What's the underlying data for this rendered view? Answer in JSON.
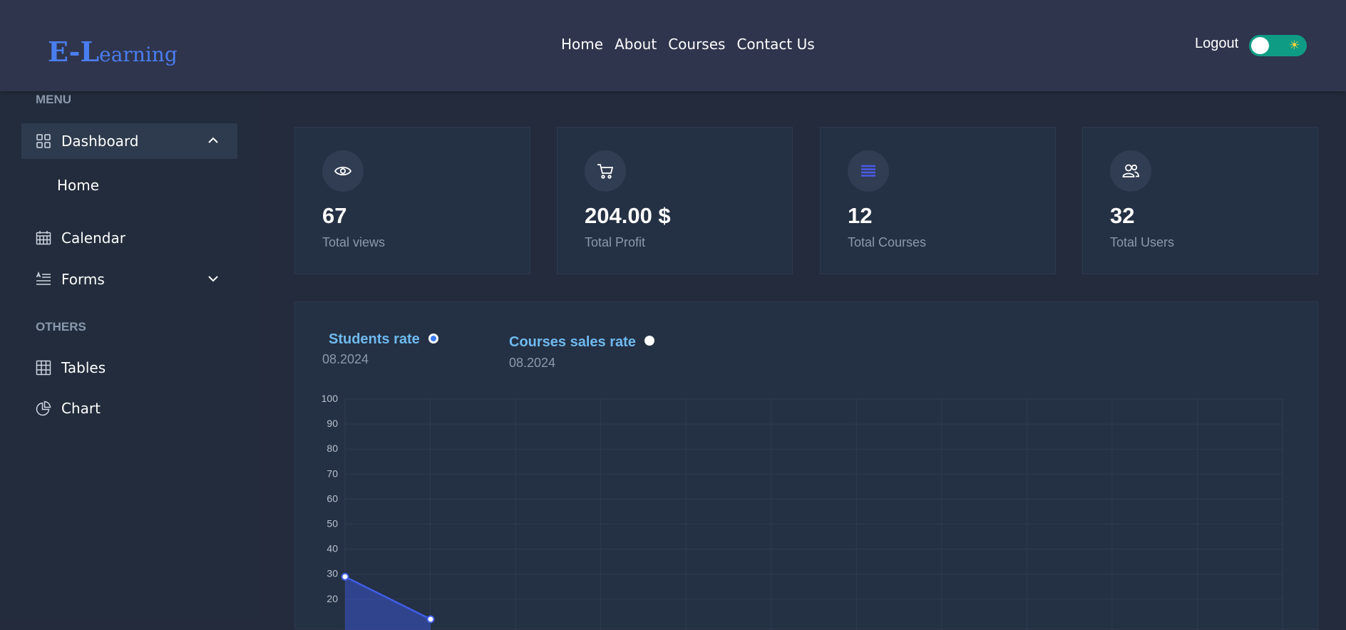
{
  "header": {
    "logo_big1": "E-",
    "logo_big2": "L",
    "logo_rest": "earning",
    "nav": [
      "Home",
      "About",
      "Courses",
      "Contact Us"
    ],
    "logout_label": "Logout",
    "toggle_icon": "sun-icon",
    "colors": {
      "accent": "#4a7ef0",
      "toggle": "#0f9c85"
    }
  },
  "sidebar": {
    "menu_label": "MENU",
    "others_label": "OTHERS",
    "dashboard_label": "Dashboard",
    "home_label": "Home",
    "calendar_label": "Calendar",
    "forms_label": "Forms",
    "tables_label": "Tables",
    "chart_label": "Chart"
  },
  "stats": [
    {
      "icon": "eye-icon",
      "value": "67",
      "label": "Total views"
    },
    {
      "icon": "cart-icon",
      "value": "204.00 $",
      "label": "Total Profit"
    },
    {
      "icon": "list-icon",
      "value": "12",
      "label": "Total Courses"
    },
    {
      "icon": "users-icon",
      "value": "32",
      "label": "Total Users"
    }
  ],
  "chart_legend": {
    "students_label": "Students rate",
    "students_date": "08.2024",
    "courses_label": "Courses sales rate",
    "courses_date": "08.2024"
  },
  "chart_data": {
    "type": "area",
    "ylim": [
      0,
      100
    ],
    "yticks": [
      100,
      90,
      80,
      70,
      60,
      50,
      40,
      30,
      20
    ],
    "series": [
      {
        "name": "Students rate",
        "color": "#3f5ee8",
        "values": [
          29,
          12
        ]
      }
    ]
  }
}
